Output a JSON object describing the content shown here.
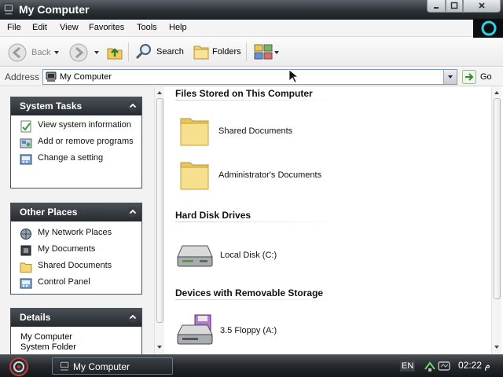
{
  "window": {
    "title": "My Computer"
  },
  "menu": [
    {
      "label": "File"
    },
    {
      "label": "Edit"
    },
    {
      "label": "View"
    },
    {
      "label": "Favorites"
    },
    {
      "label": "Tools"
    },
    {
      "label": "Help"
    }
  ],
  "toolbar": {
    "back": "Back",
    "search": "Search",
    "folders": "Folders"
  },
  "address": {
    "label": "Address",
    "value": "My Computer",
    "go": "Go"
  },
  "system_tasks": {
    "title": "System Tasks",
    "items": [
      {
        "label": "View system information",
        "icon": "system-info-icon"
      },
      {
        "label": "Add or remove programs",
        "icon": "add-remove-programs-icon"
      },
      {
        "label": "Change a setting",
        "icon": "control-panel-icon"
      }
    ]
  },
  "other_places": {
    "title": "Other Places",
    "items": [
      {
        "label": "My Network Places",
        "icon": "network-places-icon"
      },
      {
        "label": "My Documents",
        "icon": "my-documents-icon"
      },
      {
        "label": "Shared Documents",
        "icon": "folder-icon"
      },
      {
        "label": "Control Panel",
        "icon": "control-panel-icon"
      }
    ]
  },
  "details": {
    "title": "Details",
    "line1": "My Computer",
    "line2": "System Folder"
  },
  "groups": {
    "files": {
      "title": "Files Stored on This Computer",
      "items": [
        {
          "label": "Shared Documents"
        },
        {
          "label": "Administrator's Documents"
        }
      ]
    },
    "hdd": {
      "title": "Hard Disk Drives",
      "items": [
        {
          "label": "Local Disk (C:)"
        }
      ]
    },
    "removable": {
      "title": "Devices with Removable Storage",
      "items": [
        {
          "label": "3.5 Floppy (A:)"
        }
      ]
    }
  },
  "taskbar": {
    "task": "My Computer",
    "language": "EN",
    "clock": "02:22 م"
  },
  "colors": {
    "titlebar": "#2c3136",
    "panel_head": "#262a2f",
    "folder": "#f3d77a",
    "taskbar": "#24282c"
  }
}
